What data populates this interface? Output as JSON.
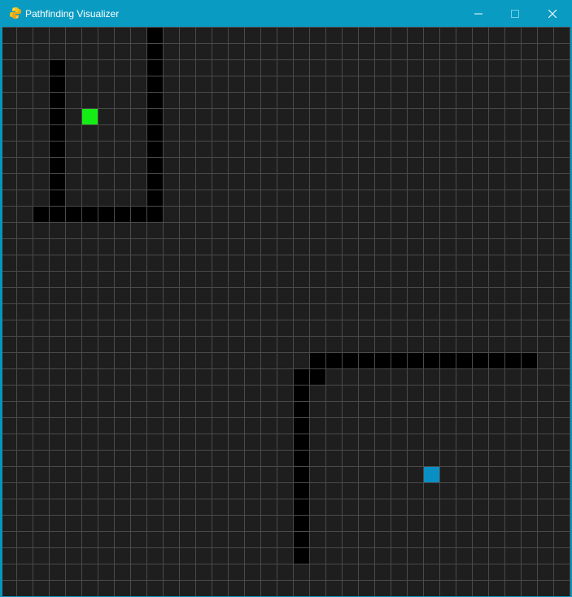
{
  "window": {
    "title": "Pathfinding Visualizer",
    "icon": "python-snake-icon",
    "controls": [
      "minimize-icon",
      "maximize-icon",
      "close-icon"
    ]
  },
  "colors": {
    "titlebar": "#0a9bc2",
    "background": "#1e1e1e",
    "grid_line": "#4a4a4a",
    "wall": "#000000",
    "start": "#14ee14",
    "end": "#0a8fc4"
  },
  "grid": {
    "columns": 35,
    "rows": 35,
    "walls": [
      [
        9,
        0
      ],
      [
        9,
        1
      ],
      [
        9,
        2
      ],
      [
        9,
        3
      ],
      [
        9,
        4
      ],
      [
        9,
        5
      ],
      [
        9,
        6
      ],
      [
        9,
        7
      ],
      [
        9,
        8
      ],
      [
        9,
        9
      ],
      [
        9,
        10
      ],
      [
        9,
        11
      ],
      [
        3,
        2
      ],
      [
        3,
        3
      ],
      [
        3,
        4
      ],
      [
        3,
        5
      ],
      [
        3,
        6
      ],
      [
        3,
        7
      ],
      [
        3,
        8
      ],
      [
        3,
        9
      ],
      [
        3,
        10
      ],
      [
        3,
        11
      ],
      [
        2,
        11
      ],
      [
        4,
        11
      ],
      [
        5,
        11
      ],
      [
        6,
        11
      ],
      [
        7,
        11
      ],
      [
        8,
        11
      ],
      [
        19,
        20
      ],
      [
        20,
        20
      ],
      [
        21,
        20
      ],
      [
        22,
        20
      ],
      [
        23,
        20
      ],
      [
        24,
        20
      ],
      [
        25,
        20
      ],
      [
        26,
        20
      ],
      [
        27,
        20
      ],
      [
        28,
        20
      ],
      [
        29,
        20
      ],
      [
        30,
        20
      ],
      [
        31,
        20
      ],
      [
        32,
        20
      ],
      [
        18,
        21
      ],
      [
        19,
        21
      ],
      [
        18,
        22
      ],
      [
        18,
        23
      ],
      [
        18,
        24
      ],
      [
        18,
        25
      ],
      [
        18,
        26
      ],
      [
        18,
        27
      ],
      [
        18,
        28
      ],
      [
        18,
        29
      ],
      [
        18,
        30
      ],
      [
        18,
        31
      ],
      [
        18,
        32
      ]
    ],
    "start": [
      5,
      5
    ],
    "end": [
      26,
      27
    ]
  }
}
